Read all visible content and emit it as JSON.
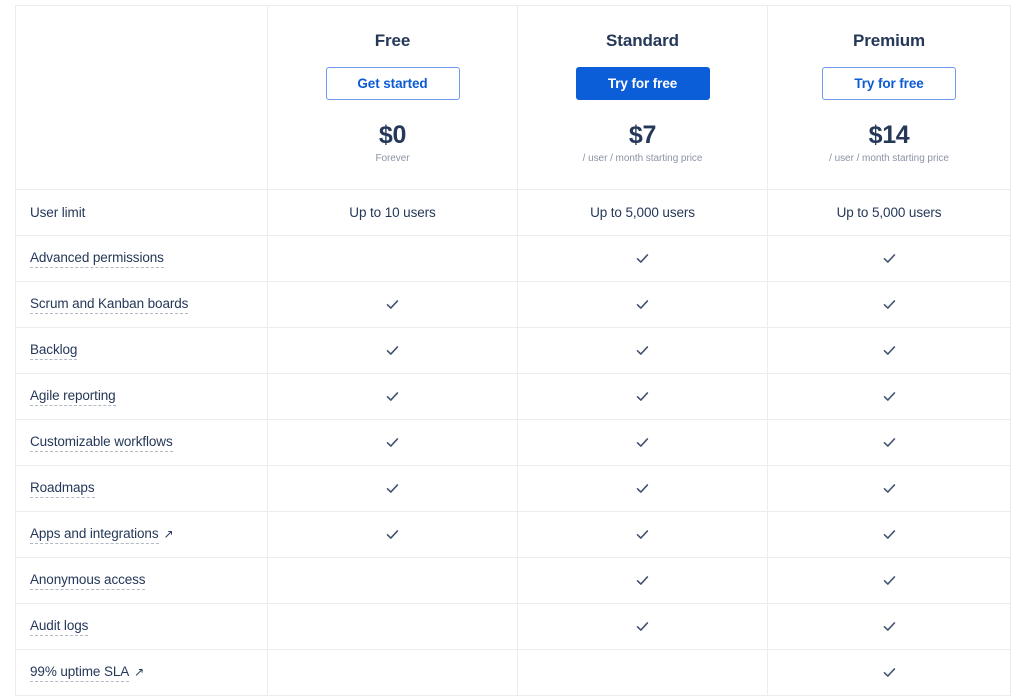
{
  "table": {
    "plans": [
      {
        "name": "Free",
        "cta_label": "Get started",
        "cta_style": "outline",
        "price": "$0",
        "price_note": "Forever"
      },
      {
        "name": "Standard",
        "cta_label": "Try for free",
        "cta_style": "solid",
        "price": "$7",
        "price_note": "/ user / month starting price"
      },
      {
        "name": "Premium",
        "cta_label": "Try for free",
        "cta_style": "outline",
        "price": "$14",
        "price_note": "/ user / month starting price"
      }
    ],
    "rows": [
      {
        "label": "User limit",
        "tooltip": false,
        "external_link": false,
        "values": [
          "Up to 10 users",
          "Up to 5,000 users",
          "Up to 5,000 users"
        ]
      },
      {
        "label": "Advanced permissions",
        "tooltip": true,
        "external_link": false,
        "values": [
          "",
          "check",
          "check"
        ]
      },
      {
        "label": "Scrum and Kanban boards",
        "tooltip": true,
        "external_link": false,
        "values": [
          "check",
          "check",
          "check"
        ]
      },
      {
        "label": "Backlog",
        "tooltip": true,
        "external_link": false,
        "values": [
          "check",
          "check",
          "check"
        ]
      },
      {
        "label": "Agile reporting",
        "tooltip": true,
        "external_link": false,
        "values": [
          "check",
          "check",
          "check"
        ]
      },
      {
        "label": "Customizable workflows",
        "tooltip": true,
        "external_link": false,
        "values": [
          "check",
          "check",
          "check"
        ]
      },
      {
        "label": "Roadmaps",
        "tooltip": true,
        "external_link": false,
        "values": [
          "check",
          "check",
          "check"
        ]
      },
      {
        "label": "Apps and integrations",
        "tooltip": true,
        "external_link": true,
        "values": [
          "check",
          "check",
          "check"
        ]
      },
      {
        "label": "Anonymous access",
        "tooltip": true,
        "external_link": false,
        "values": [
          "",
          "check",
          "check"
        ]
      },
      {
        "label": "Audit logs",
        "tooltip": true,
        "external_link": false,
        "values": [
          "",
          "check",
          "check"
        ]
      },
      {
        "label": "99% uptime SLA",
        "tooltip": true,
        "external_link": true,
        "values": [
          "",
          "",
          "check"
        ]
      }
    ],
    "external_link_glyph": "↗"
  },
  "colors": {
    "text": "#253858",
    "muted": "#8c93a4",
    "border": "#ebecf0",
    "primary": "#0b5ed7",
    "primary_outline_border": "#6e9bec",
    "primary_outline_text": "#0c5bd4",
    "check": "#42526e"
  }
}
